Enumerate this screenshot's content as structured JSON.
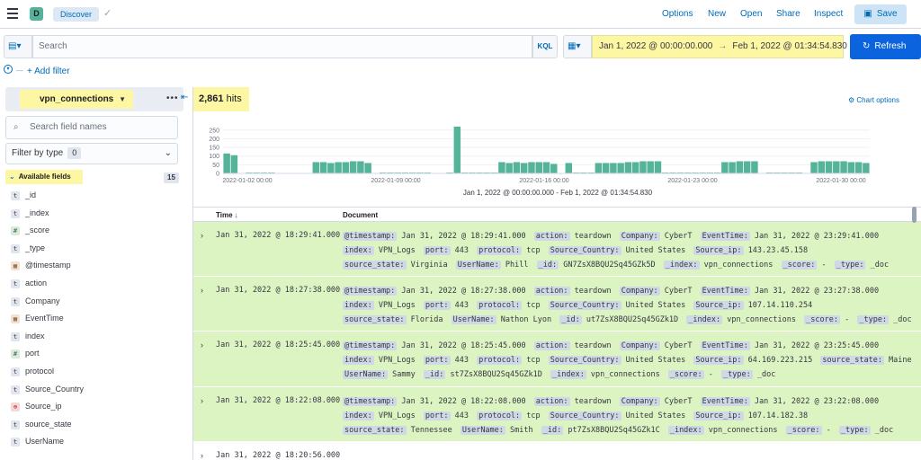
{
  "topbar": {
    "app_badge": "D",
    "breadcrumb": "Discover",
    "links": [
      "Options",
      "New",
      "Open",
      "Share",
      "Inspect"
    ],
    "save_label": "Save"
  },
  "query": {
    "placeholder": "Search",
    "language": "KQL",
    "date_start": "Jan 1, 2022 @ 00:00:00.000",
    "date_end": "Feb 1, 2022 @ 01:34:54.830",
    "refresh_label": "Refresh"
  },
  "filters": {
    "add_label": "+ Add filter"
  },
  "sidebar": {
    "index_pattern": "vpn_connections",
    "field_search_placeholder": "Search field names",
    "filter_by_type": "Filter by type",
    "filter_count": "0",
    "available_label": "Available fields",
    "available_count": "15",
    "fields": [
      {
        "name": "_id",
        "type": "t"
      },
      {
        "name": "_index",
        "type": "t"
      },
      {
        "name": "_score",
        "type": "#"
      },
      {
        "name": "_type",
        "type": "t"
      },
      {
        "name": "@timestamp",
        "type": "date"
      },
      {
        "name": "action",
        "type": "t"
      },
      {
        "name": "Company",
        "type": "t"
      },
      {
        "name": "EventTime",
        "type": "date"
      },
      {
        "name": "index",
        "type": "t"
      },
      {
        "name": "port",
        "type": "#"
      },
      {
        "name": "protocol",
        "type": "t"
      },
      {
        "name": "Source_Country",
        "type": "t"
      },
      {
        "name": "Source_ip",
        "type": "ip"
      },
      {
        "name": "source_state",
        "type": "t"
      },
      {
        "name": "UserName",
        "type": "t"
      }
    ]
  },
  "main": {
    "hits_count": "2,861",
    "hits_label": "hits",
    "chart_options_label": "Chart options",
    "time_range_label": "Jan 1, 2022 @ 00:00:00.000 - Feb 1, 2022 @ 01:34:54.830",
    "columns": {
      "time": "Time",
      "document": "Document"
    }
  },
  "chart_data": {
    "type": "bar",
    "y_ticks": [
      0,
      50,
      100,
      150,
      200,
      250
    ],
    "ylim": [
      0,
      280
    ],
    "x_tick_labels": [
      "2022-01-02 00:00",
      "2022-01-09 00:00",
      "2022-01-16 00:00",
      "2022-01-23 00:00",
      "2022-01-30 00:00"
    ],
    "values": [
      115,
      105,
      0,
      5,
      5,
      5,
      5,
      0,
      0,
      0,
      0,
      0,
      65,
      65,
      60,
      65,
      65,
      70,
      70,
      60,
      0,
      5,
      5,
      5,
      5,
      5,
      5,
      5,
      0,
      0,
      5,
      270,
      5,
      5,
      5,
      5,
      5,
      65,
      60,
      65,
      60,
      65,
      65,
      65,
      55,
      0,
      60,
      5,
      5,
      5,
      60,
      60,
      60,
      60,
      65,
      65,
      70,
      70,
      70,
      5,
      5,
      5,
      5,
      5,
      5,
      5,
      5,
      65,
      65,
      70,
      70,
      70,
      0,
      5,
      5,
      5,
      5,
      5,
      0,
      65,
      70,
      70,
      70,
      70,
      65,
      65,
      60
    ],
    "color": "#54b399"
  },
  "documents": [
    {
      "time": "Jan 31, 2022 @ 18:29:41.000",
      "fields": [
        {
          "k": "@timestamp:",
          "v": "Jan 31, 2022 @ 18:29:41.000"
        },
        {
          "k": "action:",
          "v": "teardown"
        },
        {
          "k": "Company:",
          "v": "CyberT"
        },
        {
          "k": "EventTime:",
          "v": "Jan 31, 2022 @ 23:29:41.000"
        },
        {
          "k": "index:",
          "v": "VPN_Logs"
        },
        {
          "k": "port:",
          "v": "443"
        },
        {
          "k": "protocol:",
          "v": "tcp"
        },
        {
          "k": "Source_Country:",
          "v": "United States"
        },
        {
          "k": "Source_ip:",
          "v": "143.23.45.158"
        },
        {
          "k": "source_state:",
          "v": "Virginia"
        },
        {
          "k": "UserName:",
          "v": "Phill"
        },
        {
          "k": "_id:",
          "v": "GN7ZsX8BQU2Sq45GZk5D"
        },
        {
          "k": "_index:",
          "v": "vpn_connections"
        },
        {
          "k": "_score:",
          "v": "-"
        },
        {
          "k": "_type:",
          "v": "_doc"
        }
      ]
    },
    {
      "time": "Jan 31, 2022 @ 18:27:38.000",
      "fields": [
        {
          "k": "@timestamp:",
          "v": "Jan 31, 2022 @ 18:27:38.000"
        },
        {
          "k": "action:",
          "v": "teardown"
        },
        {
          "k": "Company:",
          "v": "CyberT"
        },
        {
          "k": "EventTime:",
          "v": "Jan 31, 2022 @ 23:27:38.000"
        },
        {
          "k": "index:",
          "v": "VPN_Logs"
        },
        {
          "k": "port:",
          "v": "443"
        },
        {
          "k": "protocol:",
          "v": "tcp"
        },
        {
          "k": "Source_Country:",
          "v": "United States"
        },
        {
          "k": "Source_ip:",
          "v": "107.14.110.254"
        },
        {
          "k": "source_state:",
          "v": "Florida"
        },
        {
          "k": "UserName:",
          "v": "Nathon Lyon"
        },
        {
          "k": "_id:",
          "v": "ut7ZsX8BQU2Sq45GZk1D"
        },
        {
          "k": "_index:",
          "v": "vpn_connections"
        },
        {
          "k": "_score:",
          "v": "-"
        },
        {
          "k": "_type:",
          "v": "_doc"
        }
      ]
    },
    {
      "time": "Jan 31, 2022 @ 18:25:45.000",
      "fields": [
        {
          "k": "@timestamp:",
          "v": "Jan 31, 2022 @ 18:25:45.000"
        },
        {
          "k": "action:",
          "v": "teardown"
        },
        {
          "k": "Company:",
          "v": "CyberT"
        },
        {
          "k": "EventTime:",
          "v": "Jan 31, 2022 @ 23:25:45.000"
        },
        {
          "k": "index:",
          "v": "VPN_Logs"
        },
        {
          "k": "port:",
          "v": "443"
        },
        {
          "k": "protocol:",
          "v": "tcp"
        },
        {
          "k": "Source_Country:",
          "v": "United States"
        },
        {
          "k": "Source_ip:",
          "v": "64.169.223.215"
        },
        {
          "k": "source_state:",
          "v": "Maine"
        },
        {
          "k": "UserName:",
          "v": "Sammy"
        },
        {
          "k": "_id:",
          "v": "st7ZsX8BQU2Sq45GZk1D"
        },
        {
          "k": "_index:",
          "v": "vpn_connections"
        },
        {
          "k": "_score:",
          "v": "-"
        },
        {
          "k": "_type:",
          "v": "_doc"
        }
      ]
    },
    {
      "time": "Jan 31, 2022 @ 18:22:08.000",
      "fields": [
        {
          "k": "@timestamp:",
          "v": "Jan 31, 2022 @ 18:22:08.000"
        },
        {
          "k": "action:",
          "v": "teardown"
        },
        {
          "k": "Company:",
          "v": "CyberT"
        },
        {
          "k": "EventTime:",
          "v": "Jan 31, 2022 @ 23:22:08.000"
        },
        {
          "k": "index:",
          "v": "VPN_Logs"
        },
        {
          "k": "port:",
          "v": "443"
        },
        {
          "k": "protocol:",
          "v": "tcp"
        },
        {
          "k": "Source_Country:",
          "v": "United States"
        },
        {
          "k": "Source_ip:",
          "v": "107.14.182.38"
        },
        {
          "k": "source_state:",
          "v": "Tennessee"
        },
        {
          "k": "UserName:",
          "v": "Smith"
        },
        {
          "k": "_id:",
          "v": "pt7ZsX8BQU2Sq45GZk1C"
        },
        {
          "k": "_index:",
          "v": "vpn_connections"
        },
        {
          "k": "_score:",
          "v": "-"
        },
        {
          "k": "_type:",
          "v": "_doc"
        }
      ]
    }
  ],
  "partial_row_time": "Jan 31, 2022 @ 18:20:56.000",
  "colors": {
    "accent": "#006bb8",
    "highlight": "#fdf6a3",
    "row_bg": "#dcf3c2",
    "primary_button": "#0b64dd"
  }
}
